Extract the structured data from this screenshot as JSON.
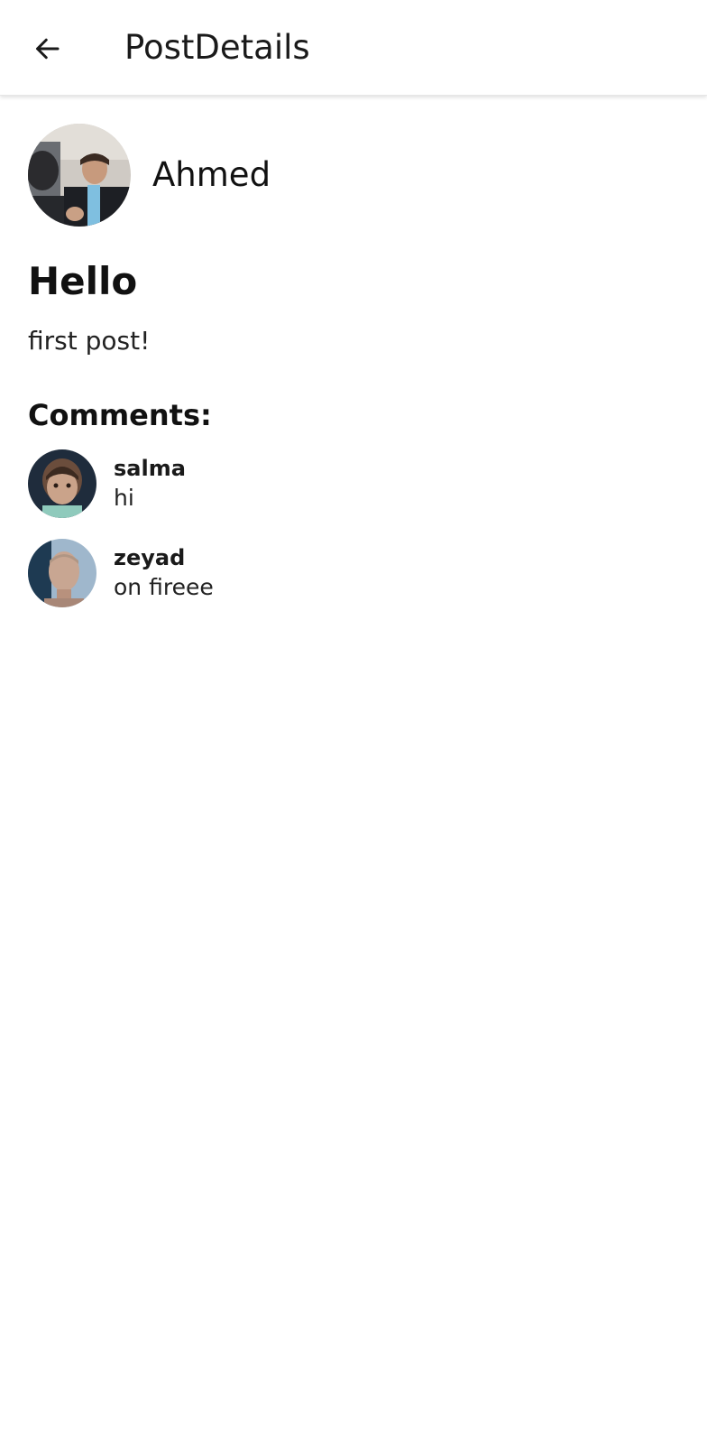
{
  "app_bar": {
    "title": "PostDetails",
    "back_icon": "arrow-left-icon"
  },
  "post": {
    "author": {
      "name": "Ahmed",
      "avatar": "avatar-photo"
    },
    "title": "Hello",
    "body": "first post!"
  },
  "comments_section": {
    "heading": "Comments:",
    "items": [
      {
        "author": "salma",
        "text": "hi",
        "avatar": "avatar-photo"
      },
      {
        "author": "zeyad",
        "text": "on fireee",
        "avatar": "avatar-photo"
      }
    ]
  },
  "colors": {
    "background": "#ffffff",
    "text": "#111111",
    "app_bar_divider": "#e6e6e6"
  }
}
